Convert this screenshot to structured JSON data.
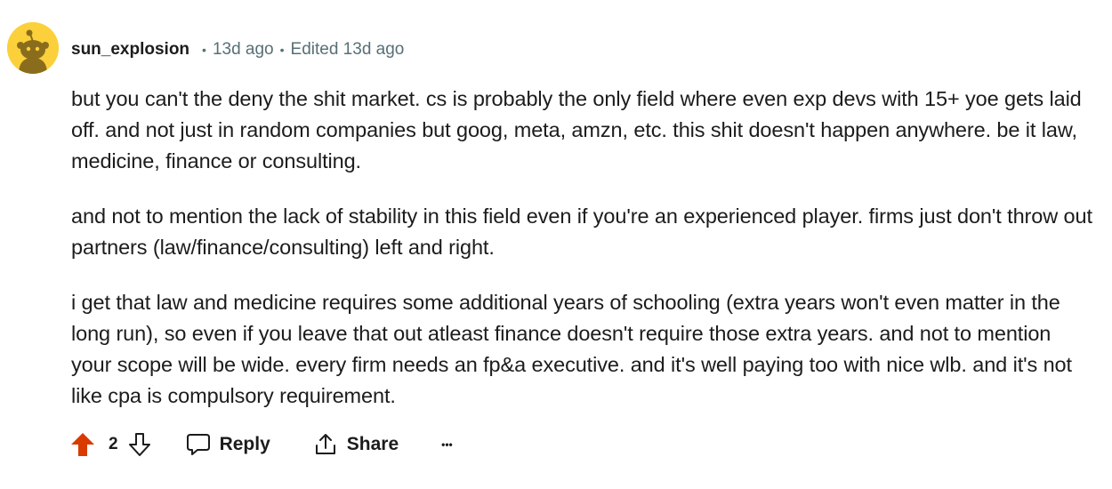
{
  "comment": {
    "username": "sun_explosion",
    "age": "13d ago",
    "edited": "Edited 13d ago",
    "separator": "•",
    "paragraphs": [
      "but you can't the deny the shit market. cs is probably the only field where even exp devs with 15+ yoe gets laid off. and not just in random companies but goog, meta, amzn, etc. this shit doesn't happen anywhere. be it law, medicine, finance or consulting.",
      "and not to mention the lack of stability in this field even if you're an experienced player. firms just don't throw out partners (law/finance/consulting) left and right.",
      "i get that law and medicine requires some additional years of schooling (extra years won't even matter in the long run), so even if you leave that out atleast finance doesn't require those extra years. and not to mention your scope will be wide. every firm needs an fp&a executive. and it's well paying too with nice wlb. and it's not like cpa is compulsory requirement."
    ]
  },
  "actions": {
    "vote_count": "2",
    "upvoted": true,
    "reply_label": "Reply",
    "share_label": "Share",
    "more_label": "•••"
  },
  "icons": {
    "upvote": "upvote-arrow-icon",
    "downvote": "downvote-arrow-icon",
    "reply": "speech-bubble-icon",
    "share": "share-arrow-icon",
    "avatar": "reddit-snoo-avatar"
  },
  "colors": {
    "upvote_active": "#d93a00",
    "meta_text": "#576f76",
    "avatar_bg": "#fcd03b",
    "text": "#1c1c1c"
  }
}
